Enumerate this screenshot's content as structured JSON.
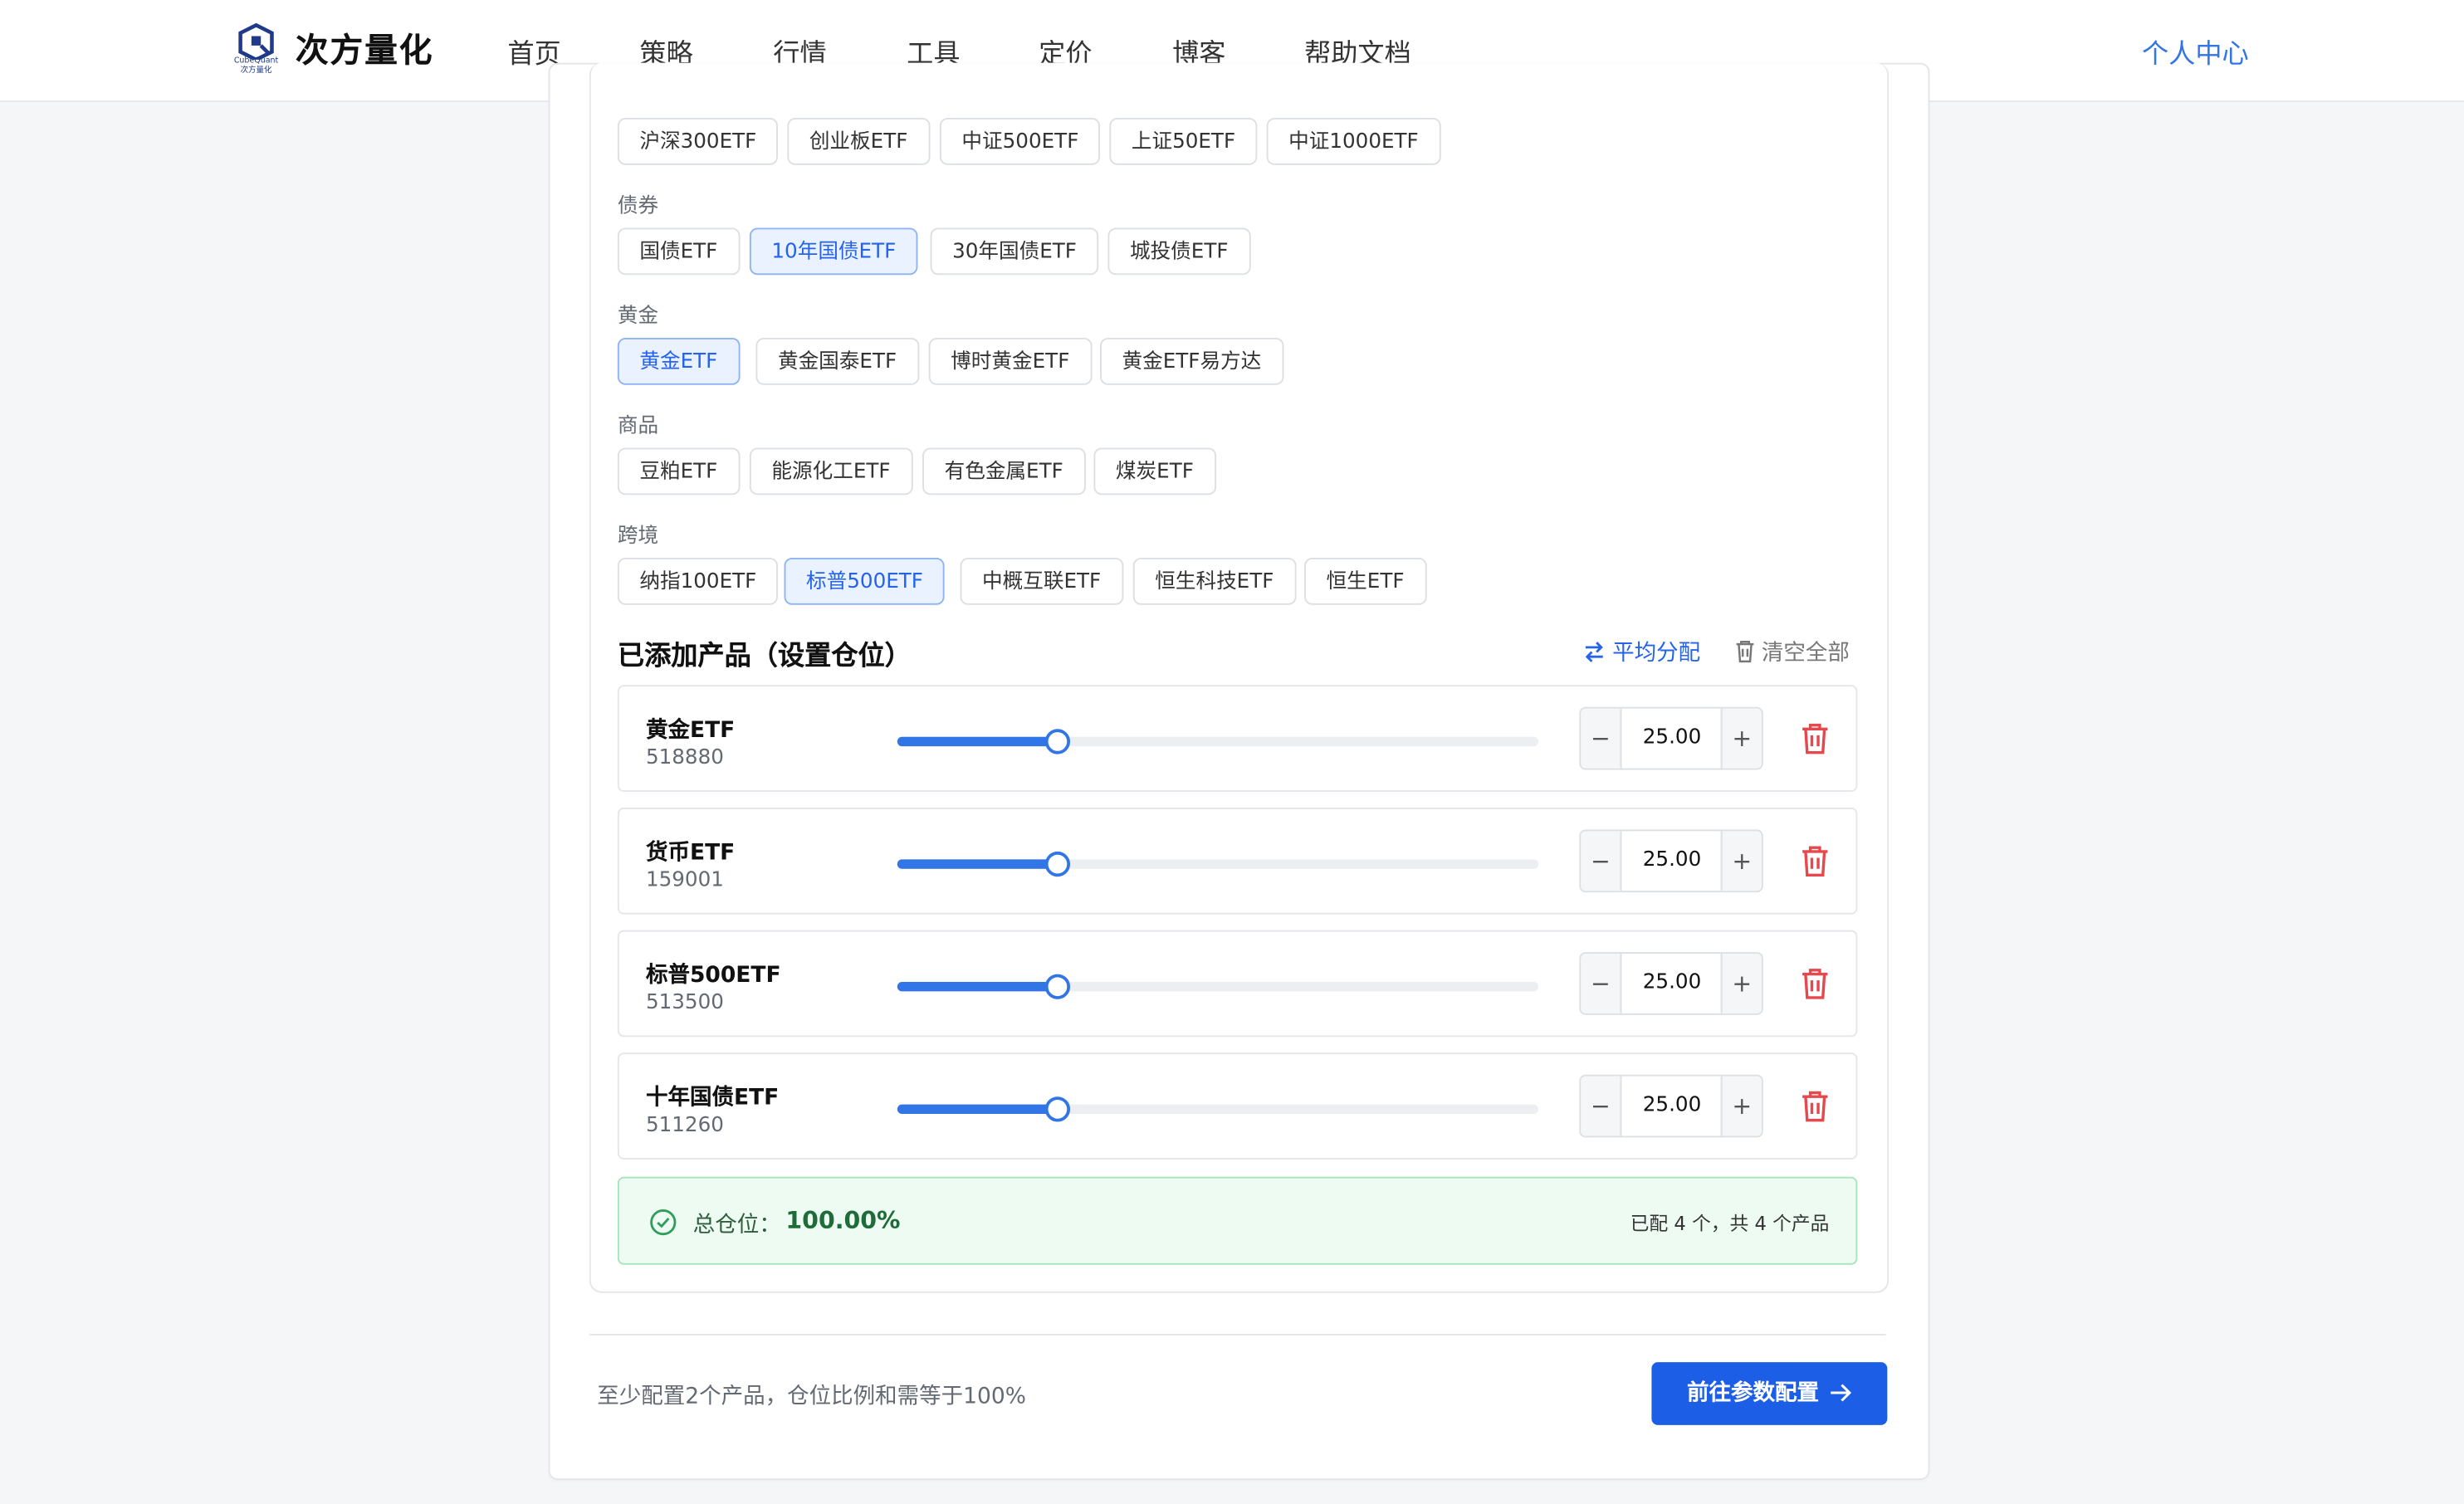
{
  "header": {
    "brand": "次方量化",
    "logo_sub": "CubeQuant 次方量化",
    "nav": [
      "首页",
      "策略",
      "行情",
      "工具",
      "定价",
      "博客",
      "帮助文档"
    ],
    "profile": "个人中心"
  },
  "categories": [
    {
      "label": "",
      "chips": [
        "沪深300ETF",
        "创业板ETF",
        "中证500ETF",
        "上证50ETF",
        "中证1000ETF"
      ],
      "selected": []
    },
    {
      "label": "债券",
      "chips": [
        "国债ETF",
        "10年国债ETF",
        "30年国债ETF",
        "城投债ETF"
      ],
      "selected": [
        1
      ]
    },
    {
      "label": "黄金",
      "chips": [
        "黄金ETF",
        "黄金国泰ETF",
        "博时黄金ETF",
        "黄金ETF易方达"
      ],
      "selected": [
        0
      ]
    },
    {
      "label": "商品",
      "chips": [
        "豆粕ETF",
        "能源化工ETF",
        "有色金属ETF",
        "煤炭ETF"
      ],
      "selected": []
    },
    {
      "label": "跨境",
      "chips": [
        "纳指100ETF",
        "标普500ETF",
        "中概互联ETF",
        "恒生科技ETF",
        "恒生ETF"
      ],
      "selected": [
        1
      ]
    }
  ],
  "added": {
    "title": "已添加产品（设置仓位）",
    "average_label": "平均分配",
    "clear_label": "清空全部",
    "items": [
      {
        "name": "黄金ETF",
        "code": "518880",
        "value": "25.00",
        "percent": 25
      },
      {
        "name": "货币ETF",
        "code": "159001",
        "value": "25.00",
        "percent": 25
      },
      {
        "name": "标普500ETF",
        "code": "513500",
        "value": "25.00",
        "percent": 25
      },
      {
        "name": "十年国债ETF",
        "code": "511260",
        "value": "25.00",
        "percent": 25
      }
    ],
    "stepper_minus": "−",
    "stepper_plus": "+"
  },
  "total": {
    "label": "总仓位：",
    "value": "100.00%",
    "count": "已配 4 个，共 4 个产品"
  },
  "footer": {
    "hint": "至少配置2个产品，仓位比例和需等于100%",
    "next_label": "前往参数配置"
  },
  "colors": {
    "accent": "#2563eb",
    "success_bg": "#edfbf2",
    "success_text": "#1f6b3a",
    "danger": "#e5484d"
  }
}
